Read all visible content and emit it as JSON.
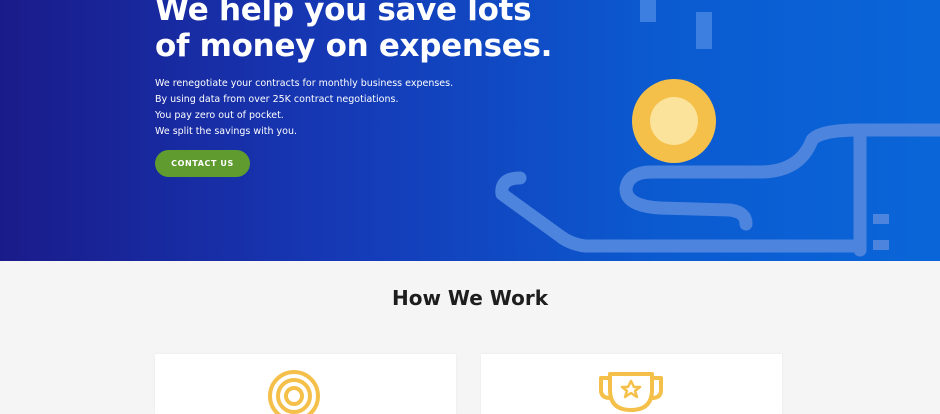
{
  "hero": {
    "title_line1": "We help you save lots",
    "title_line2": "of money on expenses.",
    "lines": [
      "We renegotiate your contracts for monthly business expenses.",
      "By using data from over 25K contract negotiations.",
      "You pay zero out of pocket.",
      "We split the savings with you."
    ],
    "cta_label": "CONTACT US"
  },
  "how_we_work": {
    "title": "How We Work"
  },
  "icons": {
    "illustration": "hand-holding-coin-icon",
    "card1": "coin-icon",
    "card2": "trophy-icon"
  },
  "colors": {
    "cta": "#5f9b2f",
    "coin": "#f5c04a",
    "hero_start": "#1a1b8a",
    "hero_end": "#0a66d8"
  }
}
